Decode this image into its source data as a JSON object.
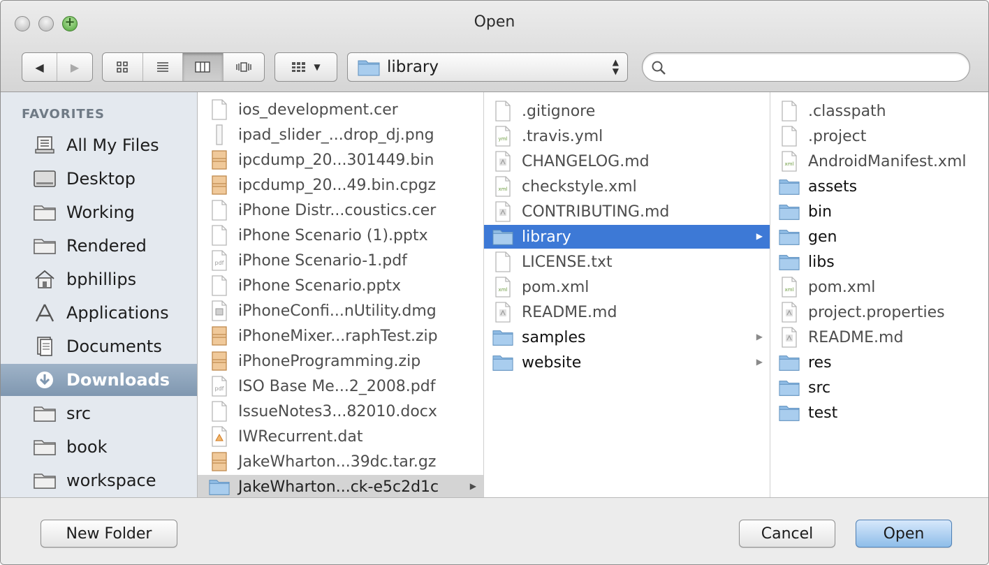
{
  "window": {
    "title": "Open"
  },
  "toolbar": {
    "back_icon": "◀",
    "forward_icon": "▶",
    "path_popup_label": "library",
    "search_placeholder": ""
  },
  "sidebar": {
    "heading": "FAVORITES",
    "items": [
      {
        "label": "All My Files",
        "icon": "all-files-icon",
        "selected": false
      },
      {
        "label": "Desktop",
        "icon": "desktop-icon",
        "selected": false
      },
      {
        "label": "Working",
        "icon": "folder-icon",
        "selected": false
      },
      {
        "label": "Rendered",
        "icon": "folder-icon",
        "selected": false
      },
      {
        "label": "bphillips",
        "icon": "home-icon",
        "selected": false
      },
      {
        "label": "Applications",
        "icon": "applications-icon",
        "selected": false
      },
      {
        "label": "Documents",
        "icon": "documents-icon",
        "selected": false
      },
      {
        "label": "Downloads",
        "icon": "downloads-icon",
        "selected": true
      },
      {
        "label": "src",
        "icon": "folder-icon",
        "selected": false
      },
      {
        "label": "book",
        "icon": "folder-icon",
        "selected": false
      },
      {
        "label": "workspace",
        "icon": "folder-icon",
        "selected": false
      }
    ]
  },
  "columns": [
    {
      "items": [
        {
          "name": "ios_development.cer",
          "type": "file"
        },
        {
          "name": "ipad_slider_...drop_dj.png",
          "type": "image"
        },
        {
          "name": "ipcdump_20...301449.bin",
          "type": "archive"
        },
        {
          "name": "ipcdump_20...49.bin.cpgz",
          "type": "archive"
        },
        {
          "name": "iPhone Distr...coustics.cer",
          "type": "file"
        },
        {
          "name": "iPhone Scenario (1).pptx",
          "type": "file"
        },
        {
          "name": "iPhone Scenario-1.pdf",
          "type": "pdf"
        },
        {
          "name": "iPhone Scenario.pptx",
          "type": "file"
        },
        {
          "name": "iPhoneConfi...nUtility.dmg",
          "type": "dmg"
        },
        {
          "name": "iPhoneMixer...raphTest.zip",
          "type": "archive"
        },
        {
          "name": "iPhoneProgramming.zip",
          "type": "archive"
        },
        {
          "name": "ISO Base Me...2_2008.pdf",
          "type": "pdf"
        },
        {
          "name": "IssueNotes3...82010.docx",
          "type": "file"
        },
        {
          "name": "IWRecurrent.dat",
          "type": "dat"
        },
        {
          "name": "JakeWharton...39dc.tar.gz",
          "type": "archive"
        },
        {
          "name": "JakeWharton...ck-e5c2d1c",
          "type": "folder",
          "state": "selected-inactive",
          "has_children": true
        }
      ]
    },
    {
      "items": [
        {
          "name": ".gitignore",
          "type": "file"
        },
        {
          "name": ".travis.yml",
          "type": "yml"
        },
        {
          "name": "CHANGELOG.md",
          "type": "md"
        },
        {
          "name": "checkstyle.xml",
          "type": "xml"
        },
        {
          "name": "CONTRIBUTING.md",
          "type": "md"
        },
        {
          "name": "library",
          "type": "folder",
          "state": "selected",
          "has_children": true
        },
        {
          "name": "LICENSE.txt",
          "type": "file"
        },
        {
          "name": "pom.xml",
          "type": "xml"
        },
        {
          "name": "README.md",
          "type": "md"
        },
        {
          "name": "samples",
          "type": "folder",
          "has_children": true
        },
        {
          "name": "website",
          "type": "folder",
          "has_children": true
        }
      ]
    },
    {
      "items": [
        {
          "name": ".classpath",
          "type": "file"
        },
        {
          "name": ".project",
          "type": "file"
        },
        {
          "name": "AndroidManifest.xml",
          "type": "xml"
        },
        {
          "name": "assets",
          "type": "folder"
        },
        {
          "name": "bin",
          "type": "folder"
        },
        {
          "name": "gen",
          "type": "folder"
        },
        {
          "name": "libs",
          "type": "folder"
        },
        {
          "name": "pom.xml",
          "type": "xml"
        },
        {
          "name": "project.properties",
          "type": "md"
        },
        {
          "name": "README.md",
          "type": "md"
        },
        {
          "name": "res",
          "type": "folder"
        },
        {
          "name": "src",
          "type": "folder"
        },
        {
          "name": "test",
          "type": "folder"
        }
      ]
    }
  ],
  "footer": {
    "new_folder_label": "New Folder",
    "cancel_label": "Cancel",
    "open_label": "Open"
  },
  "colors": {
    "selection_active": "#3d79d6",
    "selection_inactive": "#d4d4d4",
    "sidebar_bg": "#e4e9ef",
    "folder_blue": "#8fbbe4",
    "default_button": "#8ebde9"
  }
}
